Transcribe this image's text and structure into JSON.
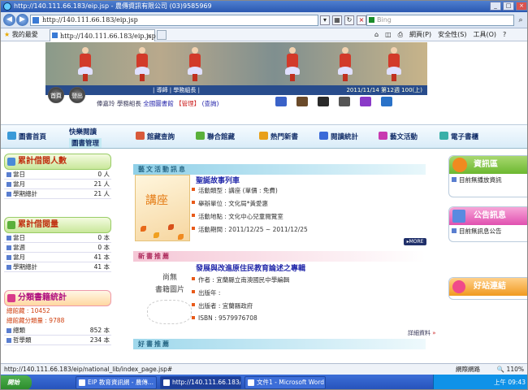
{
  "browser": {
    "title": "http://140.111.66.183/eip.jsp - 農傳資訊有限公司 (03)9585969",
    "url": "http://140.111.66.183/eip.jsp",
    "search_placeholder": "Bing",
    "favorites_label": "我的最愛",
    "tab_label": "http://140.111.66.183/eip.jsp",
    "tools": [
      "網頁(P)",
      "安全性(S)",
      "工具(O)"
    ]
  },
  "header": {
    "infobar_left": "| 導師 | 學務組長 |",
    "infobar_right": "2011/11/14 第12週 100(上)",
    "home_btn": "首頁",
    "logout_btn": "登出",
    "user_name": "俸嘉玲",
    "user_role": "學務組長",
    "user_scope": "全國圖書館",
    "user_manage": "【管理】",
    "user_query": "(查詢)",
    "toolbar_icons": [
      "mail-icon",
      "people-icon",
      "phone-icon",
      "printer-icon",
      "info-icon",
      "help-icon"
    ],
    "icon_colors": [
      "#3a62c8",
      "#6a4a2a",
      "#2a2a2a",
      "#555555",
      "#8a3ac8",
      "#2a72c8"
    ]
  },
  "nav": {
    "home": "圖書首頁",
    "fun_read": "快樂閱讀",
    "book_manage": "圖書管理",
    "collection": "館藏查詢",
    "union": "聯合館藏",
    "hot": "熱門新書",
    "stats": "閱讀統計",
    "arts": "藝文活動",
    "ebook": "電子書櫃"
  },
  "left": {
    "box1_title": "累計借閱人數",
    "box1_rows": [
      {
        "label": "當日",
        "value": "0 人"
      },
      {
        "label": "當月",
        "value": "21 人"
      },
      {
        "label": "學期總計",
        "value": "21 人"
      }
    ],
    "box2_title": "累計借閱量",
    "box2_rows": [
      {
        "label": "當日",
        "value": "0 本"
      },
      {
        "label": "當週",
        "value": "0 本"
      },
      {
        "label": "當月",
        "value": "41 本"
      },
      {
        "label": "學期總計",
        "value": "41 本"
      }
    ],
    "box3_title": "分類書籍統計",
    "total_books": "總館藏 : 10452",
    "total_classified": "總館藏分類量 : 9788",
    "box3_rows": [
      {
        "label": "總類",
        "value": "852 本"
      },
      {
        "label": "哲學類",
        "value": "234 本"
      }
    ]
  },
  "center": {
    "arts_section": "藝文活動訊息",
    "event_img_text": "講座",
    "event_title": "聖誕故事列車",
    "event_details": [
      "活動類型 : 講座  (單價 : 免費)",
      "舉辦單位 : 文化局*黃愛惠",
      "活動地點 : 文化中心兒童閱覽室",
      "活動期間 : 2011/12/25 ~ 2011/12/25"
    ],
    "more": "MORE",
    "newbook_section": "新書推薦",
    "noimg_line1": "尚無",
    "noimg_line2": "書籍圖片",
    "book_title": "發展與改進原住民教育論述之專輯",
    "book_details": [
      "作者 : 宜蘭縣立南澳國民中學編輯",
      "出版年 :",
      "出版者 : 宜蘭縣政府",
      "ISBN : 9579976708"
    ],
    "detail_more": "詳細資料",
    "good_section": "好書推薦"
  },
  "right": {
    "box1_title": "資訊區",
    "box1_text": "目前無播放資訊",
    "box2_title": "公告訊息",
    "box2_text": "目前無訊息公告",
    "box3_title": "好站連結"
  },
  "status": {
    "url": "http://140.111.66.183/eip/national_lib/index_page.jsp#",
    "network": "網際網路",
    "zoom": "110%"
  },
  "taskbar": {
    "start": "開始",
    "items": [
      "EIP 教育資訊網 - 農傳...",
      "http://140.111.66.183/eip...",
      "文件1 - Microsoft Word"
    ],
    "clock": "上午 09:43"
  }
}
